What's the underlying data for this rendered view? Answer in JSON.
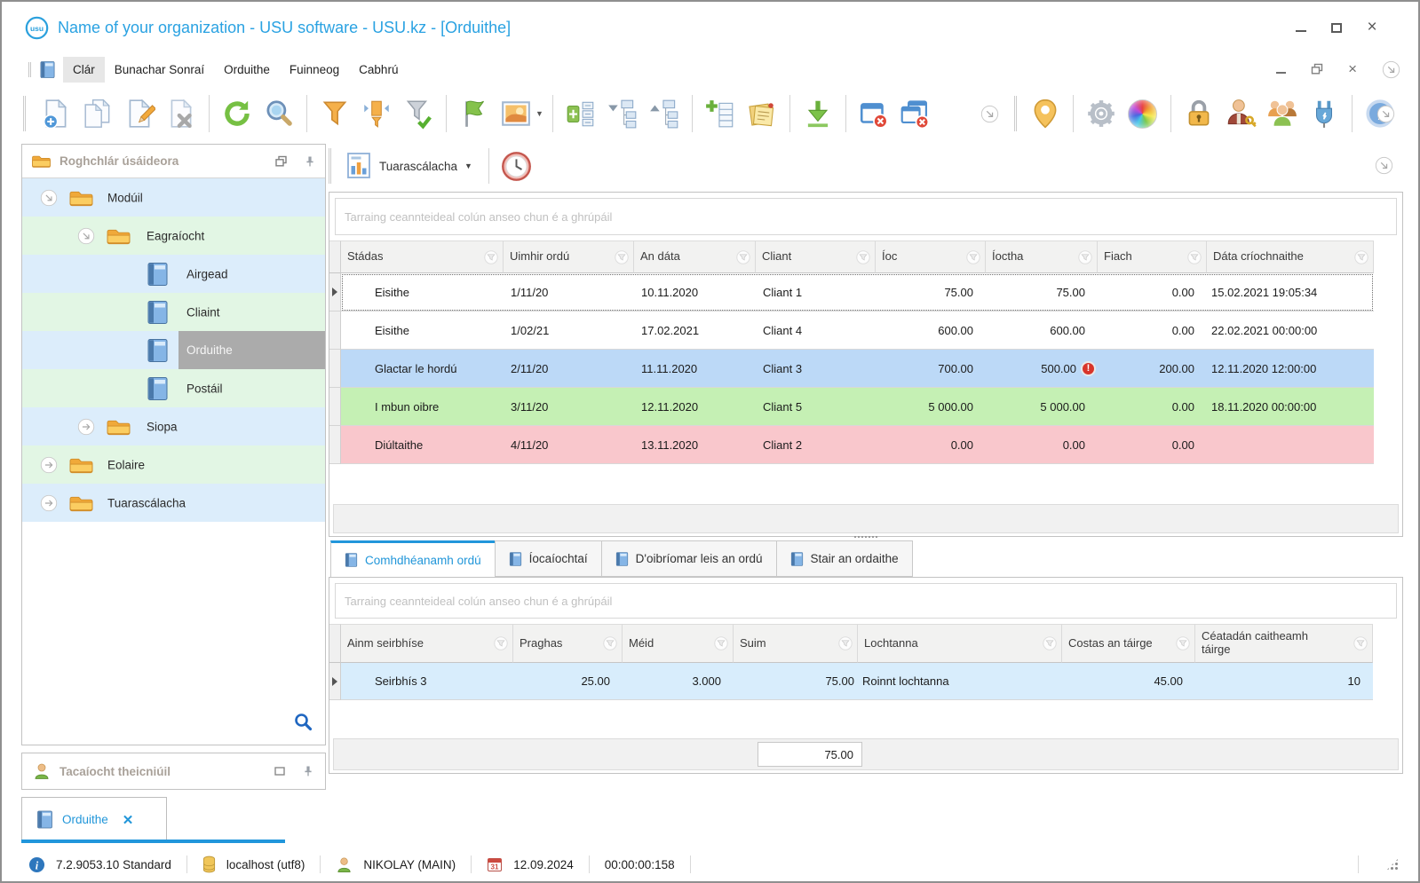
{
  "window": {
    "title": "Name of your organization - USU software - USU.kz - [Orduithe]"
  },
  "menu": {
    "items": [
      "Clár",
      "Bunachar Sonraí",
      "Orduithe",
      "Fuinneog",
      "Cabhrú"
    ]
  },
  "toolbar": {
    "icons": [
      "new-record",
      "copy-record",
      "edit-record",
      "delete-record",
      "refresh",
      "search",
      "filter",
      "filter-by-column",
      "filter-apply",
      "flag",
      "image-preview",
      "expand-card",
      "expand-tree",
      "collapse-tree",
      "add-row",
      "notes",
      "export-download",
      "close-window",
      "close-all-windows",
      "more-commands",
      "location-pin",
      "settings-gear",
      "color-scheme",
      "lock",
      "user-permissions",
      "users-group",
      "integrations-plug",
      "info"
    ]
  },
  "sidebar": {
    "title": "Roghchlár úsáideora",
    "tree": [
      {
        "label": "Modúil"
      },
      {
        "label": "Eagraíocht"
      },
      {
        "label": "Airgead"
      },
      {
        "label": "Cliaint"
      },
      {
        "label": "Orduithe"
      },
      {
        "label": "Postáil"
      },
      {
        "label": "Siopa"
      },
      {
        "label": "Eolaire"
      },
      {
        "label": "Tuarascálacha"
      }
    ],
    "support_title": "Tacaíocht theicniúil"
  },
  "report_toolbar": {
    "reports_label": "Tuarascálacha"
  },
  "main_grid": {
    "group_hint": "Tarraing ceannteideal colún anseo chun é a ghrúpáil",
    "columns": [
      "Stádas",
      "Uimhir ordú",
      "An dáta",
      "Cliant",
      "Íoc",
      "Íoctha",
      "Fiach",
      "Dáta críochnaithe"
    ],
    "rows": [
      {
        "status": "Eisithe",
        "order_no": "1/11/20",
        "date": "10.11.2020",
        "client": "Cliant 1",
        "pay": "75.00",
        "paid": "75.00",
        "debt": "0.00",
        "finished": "15.02.2021 19:05:34"
      },
      {
        "status": "Eisithe",
        "order_no": "1/02/21",
        "date": "17.02.2021",
        "client": "Cliant 4",
        "pay": "600.00",
        "paid": "600.00",
        "debt": "0.00",
        "finished": "22.02.2021 00:00:00"
      },
      {
        "status": "Glactar le hordú",
        "order_no": "2/11/20",
        "date": "11.11.2020",
        "client": "Cliant 3",
        "pay": "700.00",
        "paid": "500.00",
        "debt": "200.00",
        "finished": "12.11.2020 12:00:00"
      },
      {
        "status": "I mbun oibre",
        "order_no": "3/11/20",
        "date": "12.11.2020",
        "client": "Cliant 5",
        "pay": "5 000.00",
        "paid": "5 000.00",
        "debt": "0.00",
        "finished": "18.11.2020 00:00:00"
      },
      {
        "status": "Diúltaithe",
        "order_no": "4/11/20",
        "date": "13.11.2020",
        "client": "Cliant 2",
        "pay": "0.00",
        "paid": "0.00",
        "debt": "0.00",
        "finished": ""
      }
    ],
    "row_colors": {
      "white": "#ffffff",
      "blue": "#bcd9f7",
      "green": "#c5f0b4",
      "pink": "#f9c7cc"
    }
  },
  "detail_tabs": [
    {
      "label": "Comhdhéanamh ordú"
    },
    {
      "label": "Íocaíochtaí"
    },
    {
      "label": "D'oibríomar leis an ordú"
    },
    {
      "label": "Stair an ordaithe"
    }
  ],
  "detail_grid": {
    "group_hint": "Tarraing ceannteideal colún anseo chun é a ghrúpáil",
    "columns": [
      "Ainm seirbhíse",
      "Praghas",
      "Méid",
      "Suim",
      "Lochtanna",
      "Costas an táirge",
      "Céatadán caitheamh táirge"
    ],
    "rows": [
      {
        "service": "Seirbhís 3",
        "price": "25.00",
        "qty": "3.000",
        "sum": "75.00",
        "defects": "Roinnt lochtanna",
        "cost": "45.00",
        "wear_pct": "10"
      }
    ],
    "summary_sum": "75.00"
  },
  "doc_tabs": [
    {
      "label": "Orduithe"
    }
  ],
  "status_bar": {
    "version": "7.2.9053.10 Standard",
    "database": "localhost (utf8)",
    "user": "NIKOLAY (MAIN)",
    "date": "12.09.2024",
    "timer": "00:00:00:158"
  },
  "colors": {
    "accent": "#2aa2e2",
    "active_tab": "#2196d9",
    "selected_tree_bg": "#ababab",
    "tree_row_blue": "#dcedfb",
    "tree_row_green": "#e2f6e4"
  }
}
